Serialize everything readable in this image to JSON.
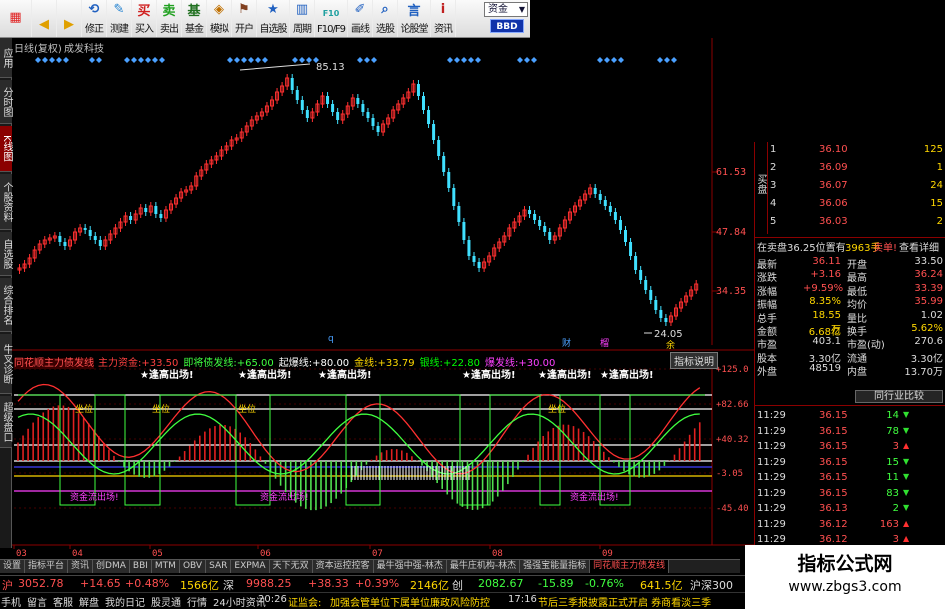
{
  "toolbar": {
    "buttons": [
      {
        "label": "",
        "icon": "app-logo-icon"
      },
      {
        "label": "",
        "icon": "back-icon"
      },
      {
        "label": "",
        "icon": "forward-icon"
      },
      {
        "label": "修正",
        "icon": "refresh-icon"
      },
      {
        "label": "测建",
        "icon": "tool-icon"
      },
      {
        "label": "买入",
        "icon": "buy-icon",
        "glyph": "买"
      },
      {
        "label": "卖出",
        "icon": "sell-icon",
        "glyph": "卖"
      },
      {
        "label": "基金",
        "icon": "fund-icon"
      },
      {
        "label": "模拟",
        "icon": "simulate-icon"
      },
      {
        "label": "开户",
        "icon": "account-icon"
      },
      {
        "label": "自选股",
        "icon": "favorites-icon"
      },
      {
        "label": "周期",
        "icon": "period-icon"
      },
      {
        "label": "F10/F9",
        "icon": "f10-icon"
      },
      {
        "label": "画线",
        "icon": "draw-icon"
      },
      {
        "label": "选股",
        "icon": "stock-filter-icon"
      },
      {
        "label": "论股堂",
        "icon": "forum-icon"
      },
      {
        "label": "资讯",
        "icon": "news-icon"
      }
    ],
    "dropdown": "资金",
    "bbd": "BBD"
  },
  "sidetabs": [
    "应用",
    "分时图",
    "K线图",
    "个股资料",
    "自选股",
    "综合排名",
    "牛叉诊断",
    "超级盘口"
  ],
  "chart": {
    "title": "日线(复权)",
    "stock_name": "成发科技",
    "high_label": "85.13",
    "low_label": "24.05",
    "price_axis": [
      "61.53",
      "47.84",
      "34.35"
    ],
    "markers": [
      "q",
      "财",
      "榴",
      "余"
    ]
  },
  "indicator": {
    "name": "同花顺主力债发线",
    "legend": [
      {
        "text": "主力资金:",
        "value": "+33.50",
        "color": "#ff4040"
      },
      {
        "text": "即将债发线:",
        "value": "+65.00",
        "color": "#40ff40"
      },
      {
        "text": "起爆线:",
        "value": "+80.00",
        "color": "#ffffff"
      },
      {
        "text": "金线:",
        "value": "+33.79",
        "color": "#ffd700"
      },
      {
        "text": "银线:",
        "value": "+22.80",
        "color": "#00ff00"
      },
      {
        "text": "爆发线:",
        "value": "+30.00",
        "color": "#ff40ff"
      }
    ],
    "help_button": "指标说明",
    "axis": [
      "+125.0",
      "+82.66",
      "+40.32",
      "-3.05",
      "-45.40"
    ],
    "labels": {
      "up": "★逢高出场!",
      "pit": "坐位",
      "burst": "爆发线",
      "fund_out": "资金流出场!"
    }
  },
  "xaxis": [
    "03",
    "04",
    "05",
    "06",
    "07",
    "08",
    "09"
  ],
  "orderbook": {
    "sell_label": "卖盘",
    "buy_label": "买盘",
    "sell": [
      {
        "lvl": "5",
        "price": "36.30",
        "vol": "1"
      },
      {
        "lvl": "4",
        "price": "36.20",
        "vol": "1"
      },
      {
        "lvl": "3",
        "price": "36.15",
        "vol": "3"
      },
      {
        "lvl": "2",
        "price": "36.12",
        "vol": "1"
      },
      {
        "lvl": "1",
        "price": "36.11",
        "vol": "2"
      }
    ],
    "buy": [
      {
        "lvl": "1",
        "price": "36.10",
        "vol": "125"
      },
      {
        "lvl": "2",
        "price": "36.09",
        "vol": "1"
      },
      {
        "lvl": "3",
        "price": "36.07",
        "vol": "24"
      },
      {
        "lvl": "4",
        "price": "36.06",
        "vol": "15"
      },
      {
        "lvl": "5",
        "price": "36.03",
        "vol": "2"
      }
    ],
    "commission": "在卖盘36.25位置有",
    "commission_vol": "3963手",
    "sell_detail": "卖单!",
    "detail_link": "查看详细"
  },
  "quote": [
    {
      "k1": "最新",
      "v1": "36.11",
      "k2": "开盘",
      "v2": "33.50"
    },
    {
      "k1": "涨跌",
      "v1": "+3.16",
      "k2": "最高",
      "v2": "36.24"
    },
    {
      "k1": "涨幅",
      "v1": "+9.59%",
      "k2": "最低",
      "v2": "33.39"
    },
    {
      "k1": "振幅",
      "v1": "8.35%",
      "k2": "均价",
      "v2": "35.99"
    },
    {
      "k1": "总手",
      "v1": "18.55万",
      "k2": "量比",
      "v2": "1.02"
    },
    {
      "k1": "金额",
      "v1": "6.68亿",
      "k2": "换手",
      "v2": "5.62%"
    },
    {
      "k1": "市盈",
      "v1": "403.1",
      "k2": "市盈(动)",
      "v2": "270.6"
    },
    {
      "k1": "股本",
      "v1": "3.30亿",
      "k2": "流通",
      "v2": "3.30亿"
    },
    {
      "k1": "外盘",
      "v1": "48519",
      "k2": "内盘",
      "v2": "13.70万"
    }
  ],
  "industry_button": "同行业比较",
  "ticks": [
    {
      "time": "11:29",
      "price": "36.15",
      "vol": "14",
      "dir": "down"
    },
    {
      "time": "11:29",
      "price": "36.15",
      "vol": "78",
      "dir": "down"
    },
    {
      "time": "11:29",
      "price": "36.15",
      "vol": "3",
      "dir": "up"
    },
    {
      "time": "11:29",
      "price": "36.15",
      "vol": "15",
      "dir": "down"
    },
    {
      "time": "11:29",
      "price": "36.15",
      "vol": "11",
      "dir": "down"
    },
    {
      "time": "11:29",
      "price": "36.15",
      "vol": "83",
      "dir": "down"
    },
    {
      "time": "11:29",
      "price": "36.13",
      "vol": "2",
      "dir": "down"
    },
    {
      "time": "11:29",
      "price": "36.12",
      "vol": "163",
      "dir": "up"
    },
    {
      "time": "11:29",
      "price": "36.12",
      "vol": "3",
      "dir": "up"
    }
  ],
  "bottom_tabs": [
    "设置",
    "指标平台",
    "资讯",
    "创DMA",
    "BBI",
    "MTM",
    "OBV",
    "SAR",
    "EXPMA",
    "天下无双",
    "资本运控控客",
    "最牛强中强-林杰",
    "最牛庄机构-林杰",
    "强强宝能量指标",
    "同花顺主力债发线"
  ],
  "status1": {
    "label1": "沪",
    "v1": "3052.78",
    "c1": "+14.65",
    "p1": "+0.48%",
    "a1": "1566亿",
    "label2": "深",
    "v2": "9988.25",
    "c2": "+38.33",
    "p2": "+0.39%",
    "a2": "2146亿",
    "label3": "创",
    "v3": "2082.67",
    "c3": "-15.89",
    "p3": "-0.76%",
    "a3": "641.5亿",
    "label4": "沪深300"
  },
  "status2": {
    "items": [
      "手机",
      "留言",
      "客服",
      "解盘",
      "我的日记",
      "股灵通",
      "行情",
      "24小时资讯"
    ],
    "news1_time": "20:26",
    "news1_src": "证监会:",
    "news1": "加强会管单位下属单位廉政风险防控",
    "news2_time": "17:16",
    "news2": "节后三季报披露正式开启 券商看淡三季"
  },
  "watermark": {
    "title": "指标公式网",
    "url": "www.zbgs3.com"
  }
}
